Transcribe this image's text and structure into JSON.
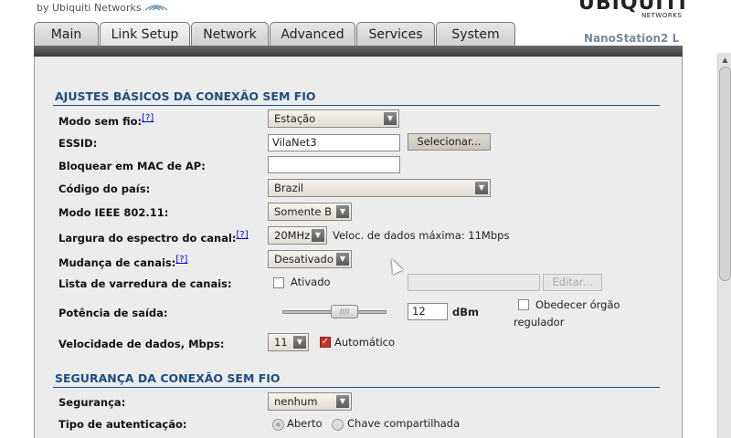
{
  "header": {
    "brand_sub": "by Ubiquiti Networks",
    "logo": "UBIQUITI",
    "logo_sub": "NETWORKS",
    "device": "NanoStation2 L"
  },
  "tabs": [
    {
      "label": "Main",
      "active": false
    },
    {
      "label": "Link Setup",
      "active": true
    },
    {
      "label": "Network",
      "active": false
    },
    {
      "label": "Advanced",
      "active": false
    },
    {
      "label": "Services",
      "active": false
    },
    {
      "label": "System",
      "active": false
    }
  ],
  "basic": {
    "title": "AJUSTES BÁSICOS DA CONEXÃO SEM FIO",
    "help": "[?]",
    "wireless_mode": {
      "label": "Modo sem fio:",
      "value": "Estação"
    },
    "essid": {
      "label": "ESSID:",
      "value": "VilaNet3",
      "button": "Selecionar..."
    },
    "lock_mac": {
      "label": "Bloquear em MAC de AP:",
      "value": ""
    },
    "country": {
      "label": "Código do país:",
      "value": "Brazil"
    },
    "ieee_mode": {
      "label": "Modo IEEE 802.11:",
      "value": "Somente B"
    },
    "channel_width": {
      "label": "Largura do espectro do canal:",
      "value": "20MHz",
      "note": "Veloc. de dados máxima: 11Mbps"
    },
    "channel_shift": {
      "label": "Mudança de canais:",
      "value": "Desativado"
    },
    "scan_list": {
      "label": "Lista de varredura de canais:",
      "checkbox_label": "Ativado",
      "checked": false,
      "value": "",
      "button": "Editar..."
    },
    "output_power": {
      "label": "Potência de saída:",
      "value": "12",
      "unit": "dBm",
      "obey_label_1": "Obedecer órgão",
      "obey_label_2": "regulador",
      "obey_checked": false
    },
    "data_rate": {
      "label": "Velocidade de dados, Mbps:",
      "value": "11",
      "auto_label": "Automático",
      "auto_checked": true
    }
  },
  "security": {
    "title": "SEGURANÇA DA CONEXÃO SEM FIO",
    "security": {
      "label": "Segurança:",
      "value": "nenhum"
    },
    "auth_type": {
      "label": "Tipo de autenticação:",
      "open_label": "Aberto",
      "shared_label": "Chave compartilhada",
      "selected": "Aberto"
    }
  },
  "colors": {
    "accent": "#1d4d80",
    "panel": "#ececec",
    "tab_bar": "#4a4a4a"
  }
}
